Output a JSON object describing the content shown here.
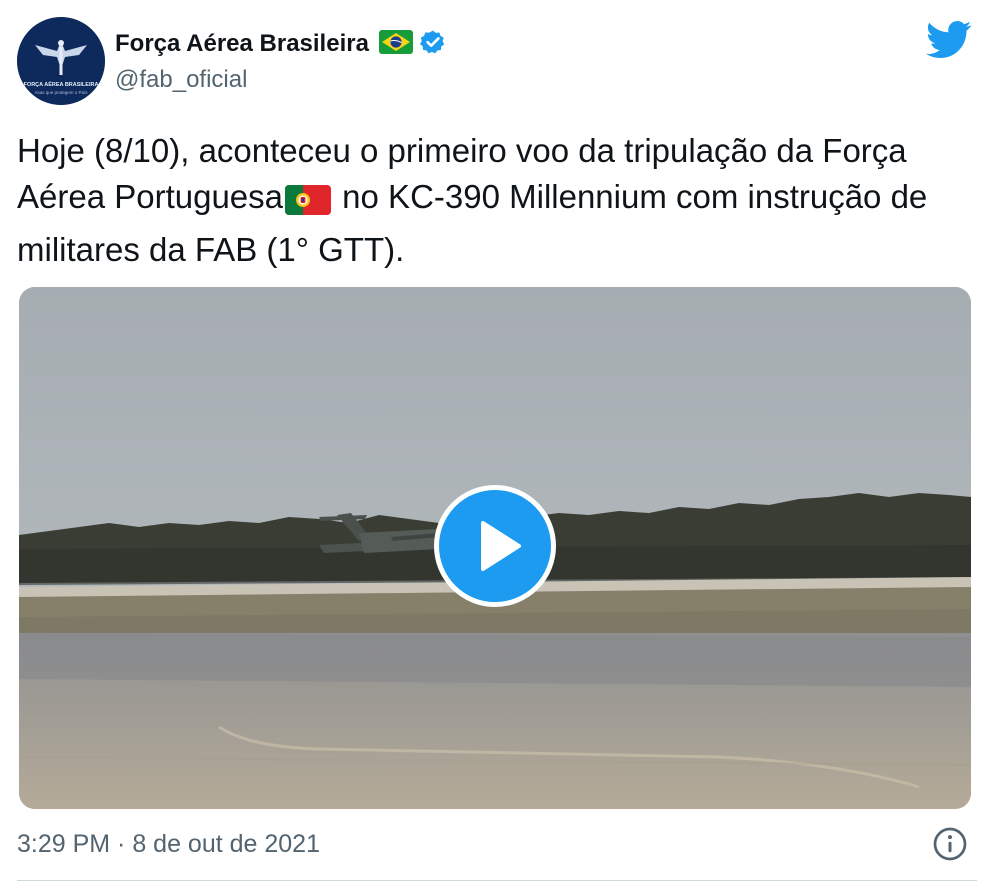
{
  "author": {
    "name": "Força Aérea Brasileira",
    "handle": "@fab_oficial",
    "verified": true,
    "avatar_caption": "FORÇA AÉREA BRASILEIRA",
    "avatar_motto": "Asas que protegem o País",
    "name_flag_icon": "brazil-flag-icon"
  },
  "tweet": {
    "text_part1": "Hoje (8/10), aconteceu o primeiro voo da tripulação da Força Aérea Portuguesa",
    "inline_flag_icon": "portugal-flag-icon",
    "text_part2": " no KC-390 Millennium com instrução de militares da FAB (1° GTT)."
  },
  "media": {
    "type": "video",
    "play_icon": "play-icon"
  },
  "footer": {
    "timestamp": "3:29 PM · 8 de out de 2021",
    "info_icon": "info-icon"
  },
  "colors": {
    "accent": "#1d9bf0",
    "text": "#0f1419",
    "secondary": "#536471",
    "avatar_bg": "#0e2a5c"
  }
}
